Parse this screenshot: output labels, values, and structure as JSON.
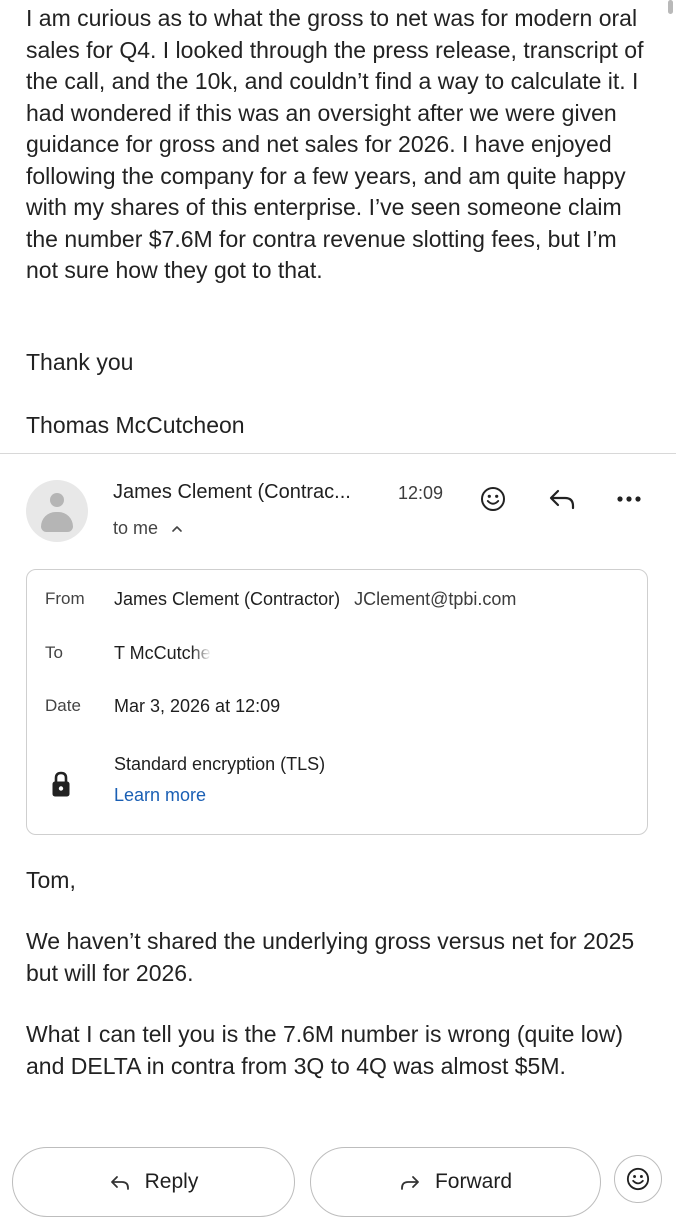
{
  "previous_message": {
    "body": "I am curious as to what the gross to net was for modern oral sales for Q4. I looked through the press release, transcript of the call, and the 10k, and couldn’t find a way to calculate it. I had wondered if this was an oversight after we were given guidance for gross and net sales for 2026. I have enjoyed following the company for a few years, and am quite happy with my shares of this enterprise. I’ve seen someone claim the number $7.6M for contra revenue slotting fees, but I’m not sure how they got to that.",
    "thanks": "Thank you",
    "signature": "Thomas McCutcheon"
  },
  "message_header": {
    "sender_name": "James Clement (Contrac...",
    "time": "12:09",
    "recipient_summary": "to me",
    "icons": [
      "avatar",
      "emoji-reaction-icon",
      "reply-icon",
      "more-options-icon",
      "chevron-up-icon"
    ]
  },
  "details": {
    "from_label": "From",
    "from_name": "James Clement (Contractor)",
    "from_email": "JClement@tpbi.com",
    "to_label": "To",
    "to_value": "T McCutche",
    "date_label": "Date",
    "date_value": "Mar 3, 2026 at 12:09",
    "security_text": "Standard encryption (TLS)",
    "learn_more": "Learn more",
    "icons": [
      "lock-icon"
    ]
  },
  "reply_body": {
    "greeting": "Tom,",
    "paragraph1": "We haven’t shared the underlying gross versus net for 2025 but will for 2026.",
    "paragraph2": "What I can tell you is the 7.6M number is wrong (quite low) and DELTA in contra from 3Q to 4Q was almost $5M."
  },
  "actions": {
    "reply_label": "Reply",
    "forward_label": "Forward",
    "icons": [
      "reply-icon",
      "forward-icon",
      "emoji-reaction-icon"
    ]
  },
  "colors": {
    "link": "#1a5fb4",
    "text": "#222222",
    "border": "#cfcfcf"
  }
}
